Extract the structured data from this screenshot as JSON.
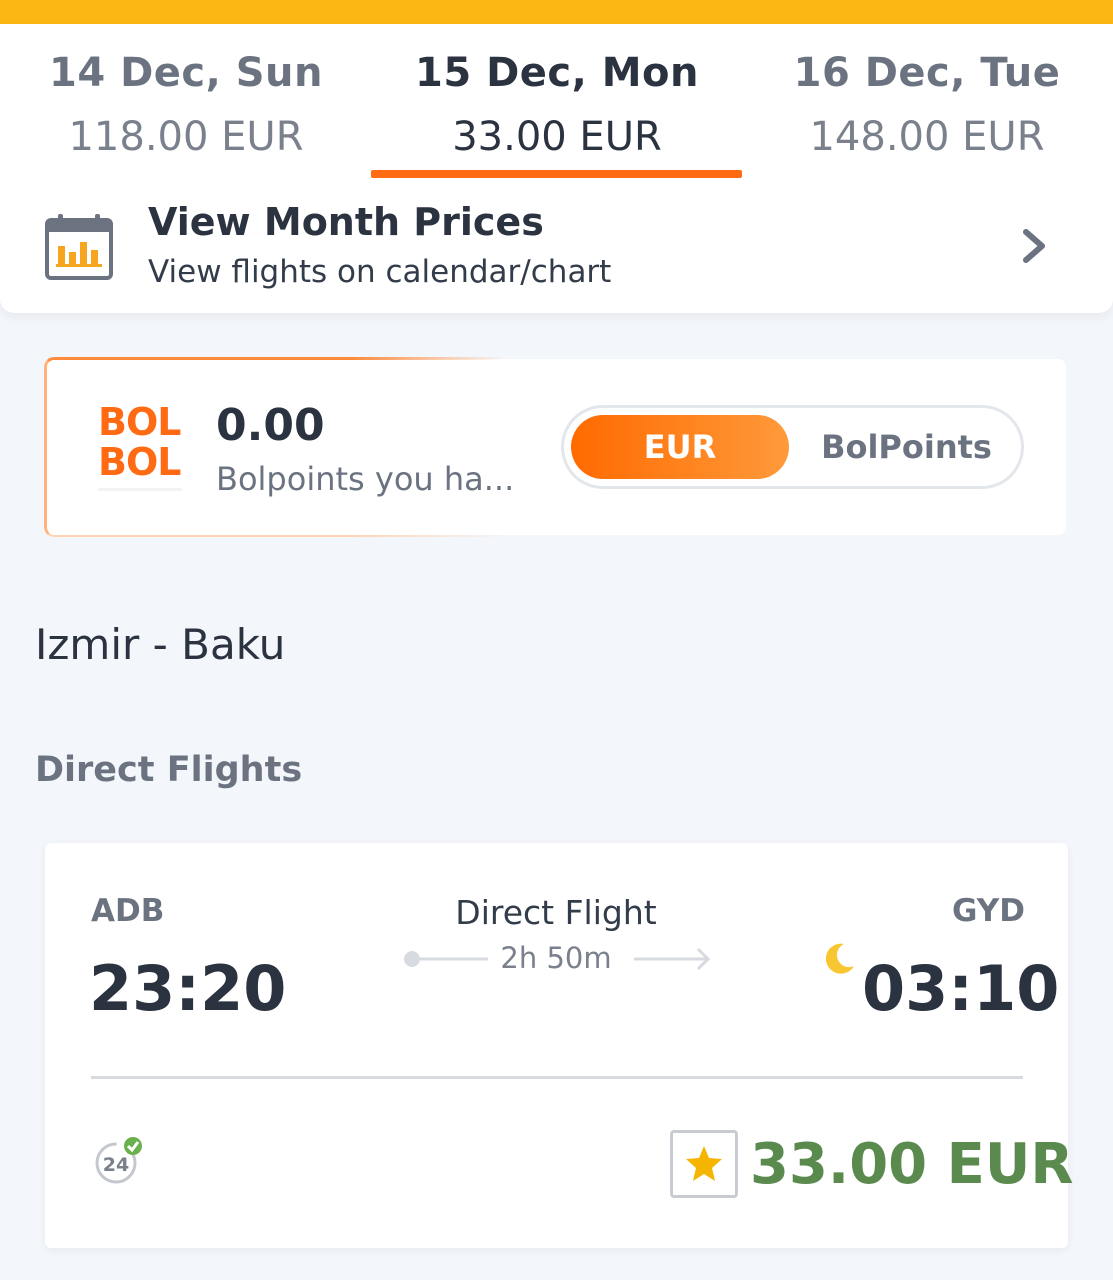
{
  "dates": [
    {
      "date": "14 Dec, Sun",
      "price": "118.00 EUR"
    },
    {
      "date": "15 Dec, Mon",
      "price": "33.00 EUR"
    },
    {
      "date": "16 Dec, Tue",
      "price": "148.00 EUR"
    }
  ],
  "month_prices": {
    "title": "View Month Prices",
    "subtitle": "View flights on calendar/chart",
    "icon": "calendar-chart-icon"
  },
  "bolbol": {
    "logo_line1": "BOL",
    "logo_line2": "BOL",
    "points": "0.00",
    "description": "Bolpoints you ha...",
    "toggle_active": "EUR",
    "toggle_inactive": "BolPoints"
  },
  "route": "Izmir - Baku",
  "section_title": "Direct Flights",
  "flight": {
    "from_code": "ADB",
    "from_time": "23:20",
    "to_code": "GYD",
    "to_time": "03:10",
    "type": "Direct Flight",
    "duration": "2h 50m",
    "price": "33.00 EUR"
  },
  "colors": {
    "accent": "#ff6a13",
    "top_strip": "#fdb714",
    "price_green": "#5a8a4e"
  }
}
